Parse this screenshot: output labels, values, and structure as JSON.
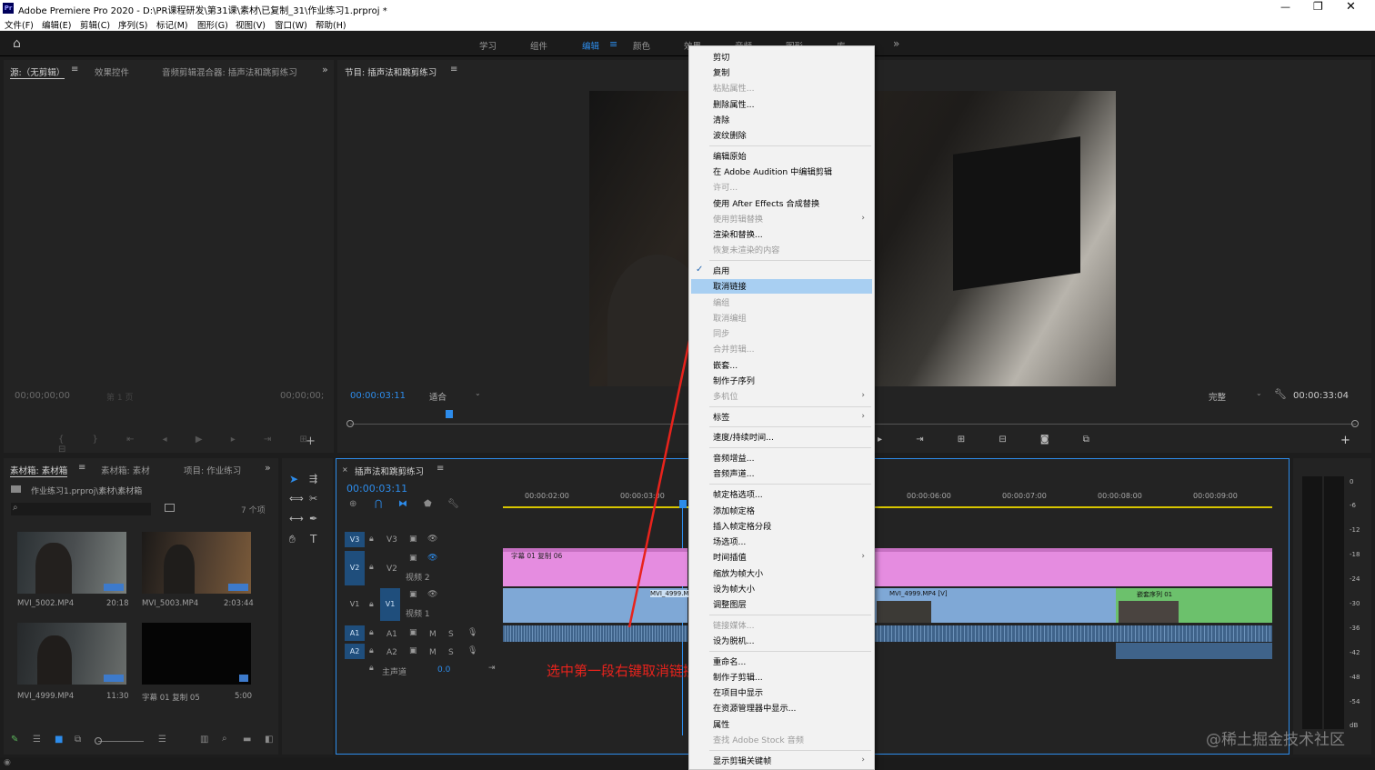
{
  "window": {
    "title": "Adobe Premiere Pro 2020 - D:\\PR课程研发\\第31课\\素材\\已复制_31\\作业练习1.prproj *"
  },
  "menubar": [
    "文件(F)",
    "编辑(E)",
    "剪辑(C)",
    "序列(S)",
    "标记(M)",
    "图形(G)",
    "视图(V)",
    "窗口(W)",
    "帮助(H)"
  ],
  "workspaces": {
    "items": [
      "学习",
      "组件",
      "编辑",
      "颜色",
      "效果",
      "音频",
      "图形",
      "库"
    ],
    "active": "编辑",
    "more": "»"
  },
  "source_panel": {
    "tabs": [
      "源:（无剪辑）",
      "效果控件",
      "音频剪辑混合器: 插声法和跳剪练习"
    ],
    "timecode_left": "00;00;00;00",
    "page_label": "第 1 页",
    "timecode_right": "00;00;00;"
  },
  "program_panel": {
    "title": "节目: 插声法和跳剪练习",
    "timecode": "00:00:03:11",
    "fit": "适合",
    "quality": "完整",
    "duration": "00:00:33:04"
  },
  "project_panel": {
    "tabs": [
      "素材箱: 素材箱",
      "素材箱: 素材",
      "项目: 作业练习"
    ],
    "path": "作业练习1.prproj\\素材\\素材箱",
    "count": "7 个项",
    "items": [
      {
        "name": "MVI_5002.MP4",
        "duration": "20:18"
      },
      {
        "name": "MVI_5003.MP4",
        "duration": "2:03:44"
      },
      {
        "name": "MVI_4999.MP4",
        "duration": "11:30"
      },
      {
        "name": "字幕 01 复制 05",
        "duration": "5:00"
      }
    ]
  },
  "timeline": {
    "title": "插声法和跳剪练习",
    "timecode": "00:00:03:11",
    "ruler": [
      "00:00:02:00",
      "00:00:03:00",
      "00:00:06:00",
      "00:00:07:00",
      "00:00:08:00",
      "00:00:09:00"
    ],
    "tracks": {
      "v3": "V3",
      "v2": "V2",
      "v2_name": "视频 2",
      "v1": "V1",
      "v1_name": "视频 1",
      "a1": "A1",
      "a2": "A2",
      "master": "主声道",
      "master_value": "0.0"
    },
    "clips": {
      "title_clip": "字幕 01 复制 06",
      "v1_clip_a": "MVI_4999.M",
      "v1_clip_b": "MVI_4999.MP4 [V]",
      "nested": "嵌套序列 01"
    }
  },
  "audio_meter": {
    "labels": [
      "0",
      "-6",
      "-12",
      "-18",
      "-24",
      "-30",
      "-36",
      "-42",
      "-48",
      "-54",
      "dB"
    ]
  },
  "context_menu": {
    "items": [
      {
        "label": "剪切",
        "disabled": false
      },
      {
        "label": "复制",
        "disabled": false
      },
      {
        "label": "粘贴属性...",
        "disabled": true
      },
      {
        "label": "删除属性...",
        "disabled": false
      },
      {
        "label": "清除",
        "disabled": false
      },
      {
        "label": "波纹删除",
        "disabled": false
      },
      {
        "label": "编辑原始",
        "disabled": false
      },
      {
        "label": "在 Adobe Audition 中编辑剪辑",
        "disabled": false
      },
      {
        "label": "许可...",
        "disabled": true
      },
      {
        "label": "使用 After Effects 合成替换",
        "disabled": false
      },
      {
        "label": "使用剪辑替换",
        "disabled": true
      },
      {
        "label": "渲染和替换...",
        "disabled": false
      },
      {
        "label": "恢复未渲染的内容",
        "disabled": true
      },
      {
        "label": "启用",
        "disabled": false
      },
      {
        "label": "取消链接",
        "disabled": false
      },
      {
        "label": "编组",
        "disabled": true
      },
      {
        "label": "取消编组",
        "disabled": true
      },
      {
        "label": "同步",
        "disabled": true
      },
      {
        "label": "合并剪辑...",
        "disabled": true
      },
      {
        "label": "嵌套...",
        "disabled": false
      },
      {
        "label": "制作子序列",
        "disabled": false
      },
      {
        "label": "多机位",
        "disabled": true
      },
      {
        "label": "标签",
        "disabled": false
      },
      {
        "label": "速度/持续时间...",
        "disabled": false
      },
      {
        "label": "音频增益...",
        "disabled": false
      },
      {
        "label": "音频声道...",
        "disabled": false
      },
      {
        "label": "帧定格选项...",
        "disabled": false
      },
      {
        "label": "添加帧定格",
        "disabled": false
      },
      {
        "label": "插入帧定格分段",
        "disabled": false
      },
      {
        "label": "场选项...",
        "disabled": false
      },
      {
        "label": "时间插值",
        "disabled": false
      },
      {
        "label": "缩放为帧大小",
        "disabled": false
      },
      {
        "label": "设为帧大小",
        "disabled": false
      },
      {
        "label": "调整图层",
        "disabled": false
      },
      {
        "label": "链接媒体...",
        "disabled": true
      },
      {
        "label": "设为脱机...",
        "disabled": false
      },
      {
        "label": "重命名...",
        "disabled": false
      },
      {
        "label": "制作子剪辑...",
        "disabled": false
      },
      {
        "label": "在项目中显示",
        "disabled": false
      },
      {
        "label": "在资源管理器中显示...",
        "disabled": false
      },
      {
        "label": "属性",
        "disabled": false
      },
      {
        "label": "查找 Adobe Stock 音频",
        "disabled": true
      },
      {
        "label": "显示剪辑关键帧",
        "disabled": false
      }
    ],
    "highlighted": "取消链接",
    "checked": "启用"
  },
  "annotation": {
    "text": "选中第一段右键取消链接",
    "color": "#e8231c"
  },
  "watermark": "@稀土掘金技术社区",
  "colors": {
    "accent": "#2d8ceb",
    "title_clip": "#e58ce0",
    "video_clip": "#7fa8d6",
    "nested_clip": "#6cc16c",
    "menu_highlight": "#a8cff2"
  }
}
